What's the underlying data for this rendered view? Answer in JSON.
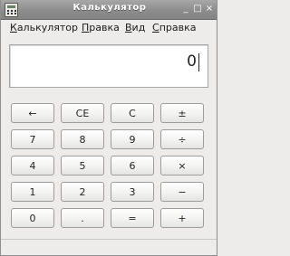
{
  "window": {
    "title": "Калькулятор",
    "controls": {
      "minimize": "_",
      "maximize": "□",
      "close": "×"
    }
  },
  "menu": {
    "items": [
      "Калькулятор",
      "Правка",
      "Вид",
      "Справка"
    ]
  },
  "display": {
    "value": "0"
  },
  "keypad": {
    "rows": [
      [
        "←",
        "CE",
        "C",
        "±"
      ],
      [
        "7",
        "8",
        "9",
        "÷"
      ],
      [
        "4",
        "5",
        "6",
        "×"
      ],
      [
        "1",
        "2",
        "3",
        "−"
      ],
      [
        "0",
        ".",
        "=",
        "+"
      ]
    ]
  },
  "colors": {
    "titlebar": "#8d8d8d",
    "window_bg": "#edeceb",
    "display_bg": "#ffffff"
  },
  "icons": {
    "app": "calculator-icon"
  }
}
